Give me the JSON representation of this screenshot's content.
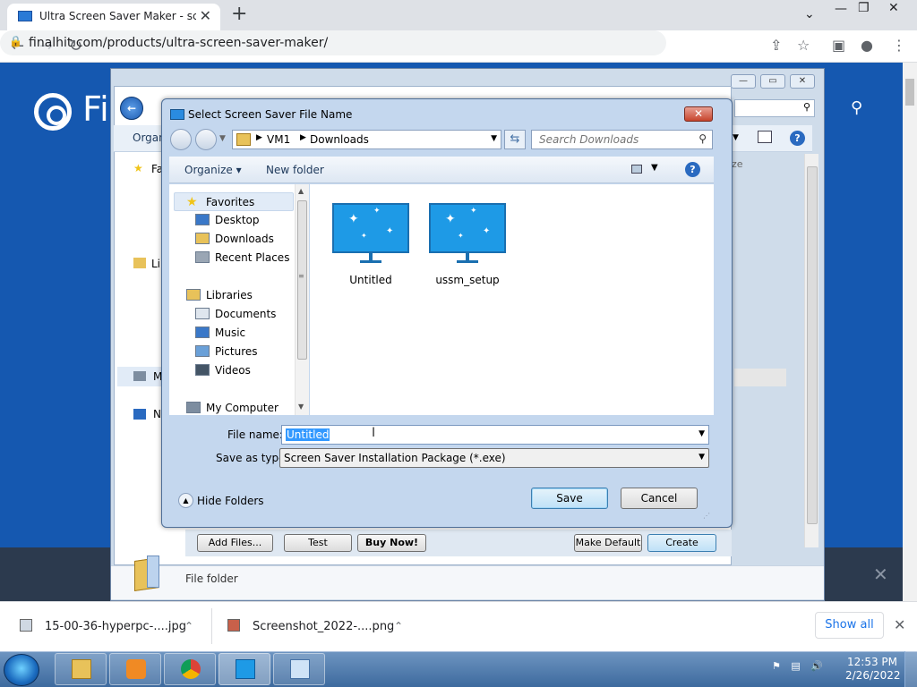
{
  "browser": {
    "tab_title": "Ultra Screen Saver Maker - scree",
    "tab_close": "✕",
    "new_tab": "+",
    "url": "finalhit.com/products/ultra-screen-saver-maker/",
    "window_controls": {
      "dropdown": "⌄",
      "minimize": "—",
      "restore": "❐",
      "close": "✕"
    }
  },
  "page": {
    "logo_text": "Fi",
    "banner_close": "✕"
  },
  "outer_window": {
    "organize": "Organ",
    "right_col": "ze",
    "status_text": "File folder",
    "buttons": {
      "add_files": "Add Files...",
      "test": "Test",
      "buy_now": "Buy Now!",
      "make_default": "Make Default",
      "create": "Create"
    },
    "sidebar_letters": [
      "Fa",
      "Li",
      "M",
      "N"
    ]
  },
  "dialog": {
    "title": "Select Screen Saver File Name",
    "close": "✕",
    "breadcrumb": [
      "VM1",
      "Downloads"
    ],
    "search_placeholder": "Search Downloads",
    "toolbar": {
      "organize": "Organize ▾",
      "new_folder": "New folder",
      "help": "?"
    },
    "nav": [
      {
        "label": "Favorites",
        "level": 0,
        "icon": "star-icon",
        "color": "#f0c419"
      },
      {
        "label": "Desktop",
        "level": 1,
        "icon": "desktop-icon",
        "color": "#3a78c8"
      },
      {
        "label": "Downloads",
        "level": 1,
        "icon": "downloads-folder-icon",
        "color": "#e8c25a"
      },
      {
        "label": "Recent Places",
        "level": 1,
        "icon": "recent-places-icon",
        "color": "#9aa6b4"
      },
      {
        "label": "Libraries",
        "level": 0,
        "icon": "libraries-icon",
        "color": "#e8c25a"
      },
      {
        "label": "Documents",
        "level": 1,
        "icon": "documents-icon",
        "color": "#dfe6ee"
      },
      {
        "label": "Music",
        "level": 1,
        "icon": "music-icon",
        "color": "#3a78c8"
      },
      {
        "label": "Pictures",
        "level": 1,
        "icon": "pictures-icon",
        "color": "#6aa0d8"
      },
      {
        "label": "Videos",
        "level": 1,
        "icon": "videos-icon",
        "color": "#445566"
      },
      {
        "label": "My Computer",
        "level": 0,
        "icon": "computer-icon",
        "color": "#7d8da0"
      }
    ],
    "files": [
      {
        "name": "Untitled",
        "icon": "screensaver-file-icon"
      },
      {
        "name": "ussm_setup",
        "icon": "screensaver-file-icon"
      }
    ],
    "file_name_label": "File name:",
    "file_name_value": "Untitled",
    "save_type_label": "Save as type:",
    "save_type_value": "Screen Saver Installation Package (*.exe)",
    "hide_folders": "Hide Folders",
    "save": "Save",
    "cancel": "Cancel"
  },
  "downloads": [
    {
      "name": "15-00-36-hyperpc-....jpg"
    },
    {
      "name": "Screenshot_2022-....png"
    }
  ],
  "downloads_show_all": "Show all",
  "downloads_close": "✕",
  "taskbar": {
    "apps": [
      "file-explorer-icon",
      "media-player-icon",
      "chrome-icon",
      "screensaver-maker-icon",
      "control-panel-icon"
    ],
    "time": "12:53 PM",
    "date": "2/26/2022"
  }
}
